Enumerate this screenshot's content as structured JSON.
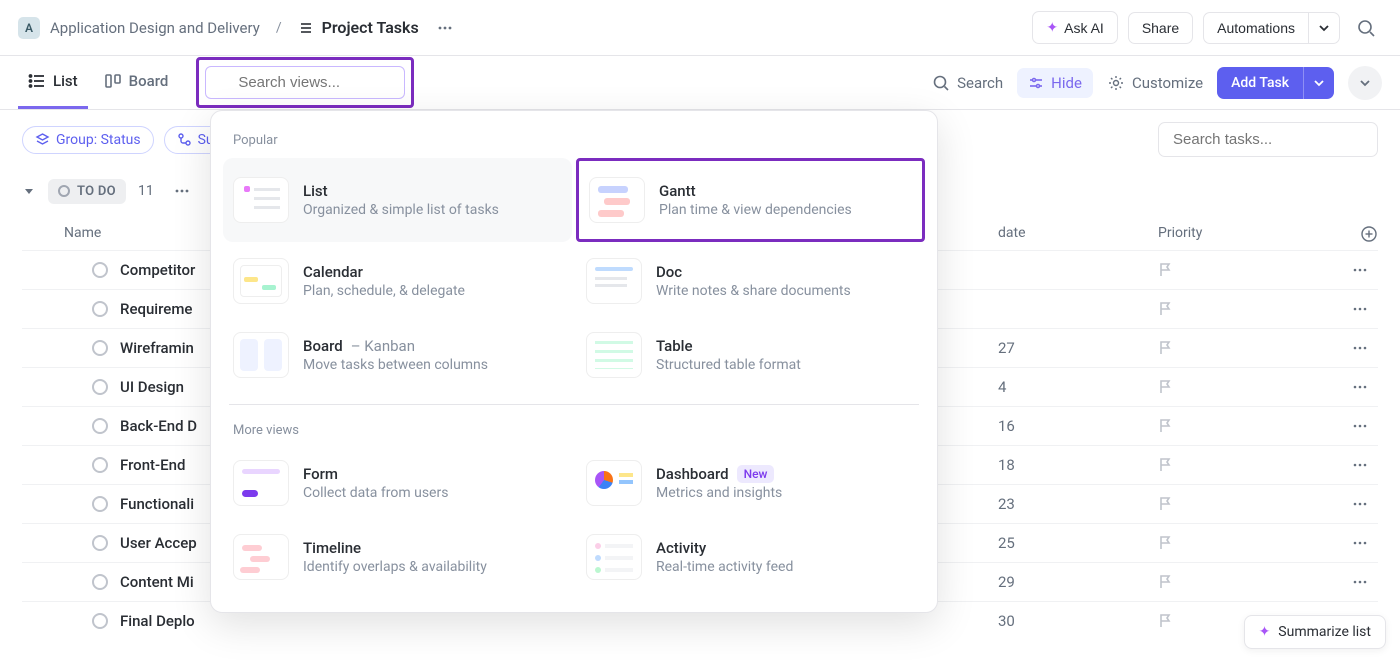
{
  "header": {
    "workspace_initial": "A",
    "breadcrumb_parent": "Application Design and Delivery",
    "breadcrumb_title": "Project Tasks",
    "ask_ai": "Ask AI",
    "share": "Share",
    "automations": "Automations"
  },
  "tabs": {
    "list": "List",
    "board": "Board",
    "search_placeholder": "Search views..."
  },
  "tools": {
    "search": "Search",
    "hide": "Hide",
    "customize": "Customize",
    "add_task": "Add Task"
  },
  "filters": {
    "group": "Group: Status",
    "subtasks_partial": "Su",
    "search_tasks_placeholder": "Search tasks..."
  },
  "group": {
    "status": "TO DO",
    "count": "11"
  },
  "columns": {
    "name": "Name",
    "date": "date",
    "priority": "Priority"
  },
  "tasks": [
    {
      "name": "Competitor",
      "date": ""
    },
    {
      "name": "Requireme",
      "date": ""
    },
    {
      "name": "Wireframin",
      "date": "27"
    },
    {
      "name": "UI Design",
      "date": "4"
    },
    {
      "name": "Back-End D",
      "date": "16"
    },
    {
      "name": "Front-End",
      "date": "18"
    },
    {
      "name": "Functionali",
      "date": "23"
    },
    {
      "name": "User Accep",
      "date": "25"
    },
    {
      "name": "Content Mi",
      "date": "29"
    },
    {
      "name": "Final Deplo",
      "date": "30"
    }
  ],
  "views_panel": {
    "popular_label": "Popular",
    "more_label": "More views",
    "items": {
      "list": {
        "title": "List",
        "desc": "Organized & simple list of tasks"
      },
      "gantt": {
        "title": "Gantt",
        "desc": "Plan time & view dependencies"
      },
      "calendar": {
        "title": "Calendar",
        "desc": "Plan, schedule, & delegate"
      },
      "doc": {
        "title": "Doc",
        "desc": "Write notes & share documents"
      },
      "board": {
        "title": "Board",
        "subtitle": "– Kanban",
        "desc": "Move tasks between columns"
      },
      "table": {
        "title": "Table",
        "desc": "Structured table format"
      },
      "form": {
        "title": "Form",
        "desc": "Collect data from users"
      },
      "dashboard": {
        "title": "Dashboard",
        "badge": "New",
        "desc": "Metrics and insights"
      },
      "timeline": {
        "title": "Timeline",
        "desc": "Identify overlaps & availability"
      },
      "activity": {
        "title": "Activity",
        "desc": "Real-time activity feed"
      }
    }
  },
  "summarize": "Summarize list"
}
